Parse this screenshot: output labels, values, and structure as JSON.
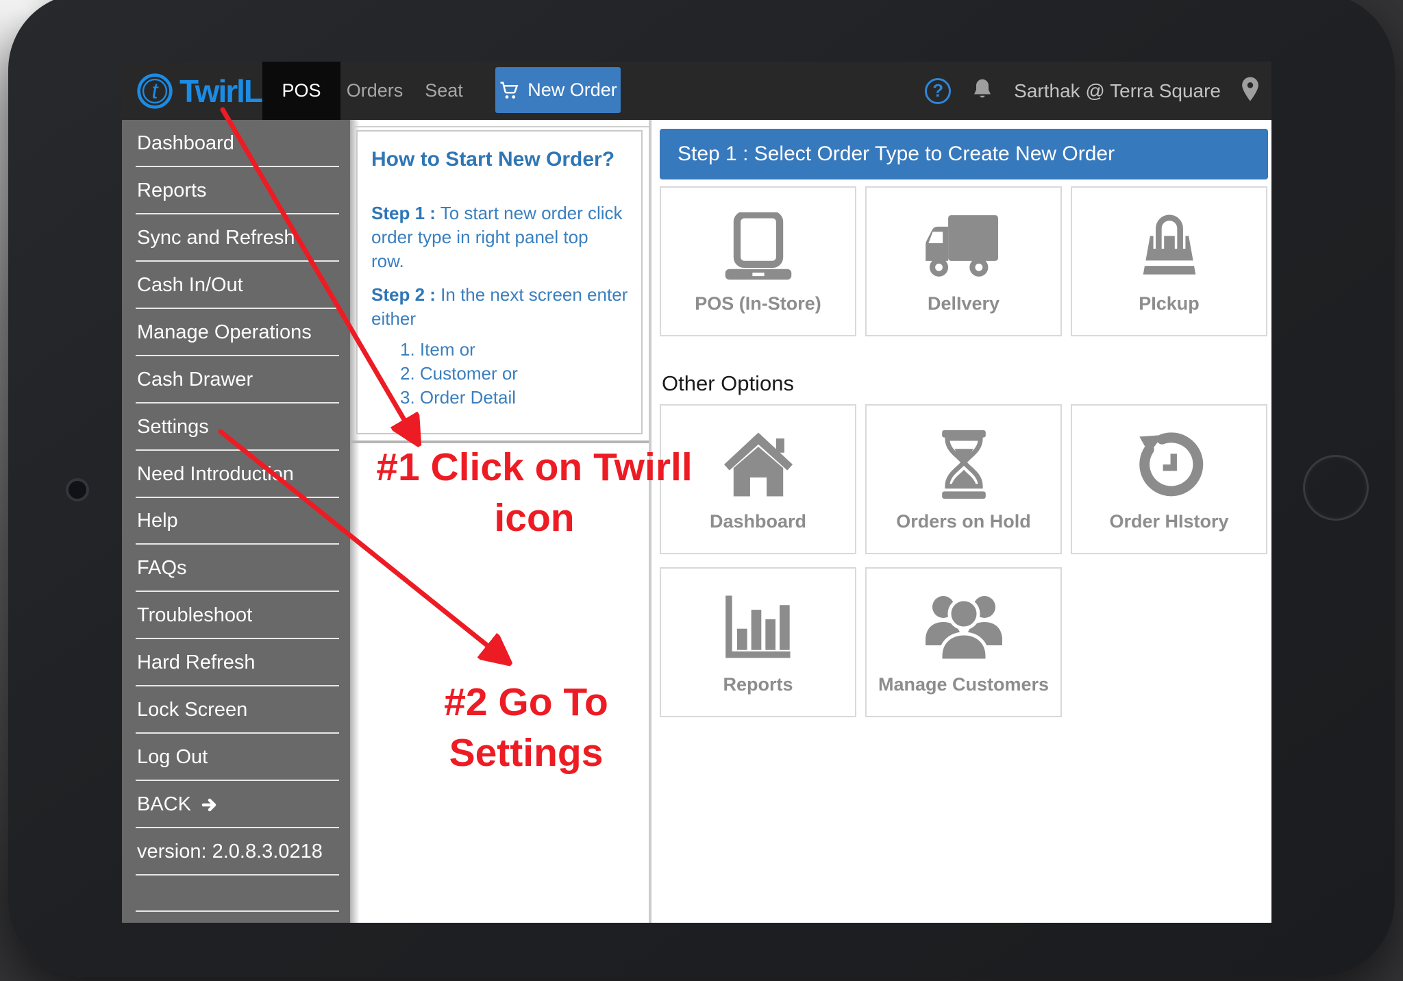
{
  "nav": {
    "brand": "TwirlL",
    "tabs": [
      {
        "label": "POS",
        "active": true
      },
      {
        "label": "Orders",
        "active": false
      },
      {
        "label": "Seat",
        "active": false
      }
    ],
    "new_order": {
      "label": "New Order",
      "icon": "cart-icon",
      "color": "#3b7cc1"
    },
    "help_glyph": "?",
    "user": {
      "label": "Sarthak @ Terra Square",
      "icon": "location-pin-icon"
    }
  },
  "sidebar": {
    "items": [
      {
        "label": "Dashboard"
      },
      {
        "label": "Reports"
      },
      {
        "label": "Sync and Refresh"
      },
      {
        "label": "Cash In/Out"
      },
      {
        "label": "Manage Operations"
      },
      {
        "label": "Cash Drawer"
      },
      {
        "label": "Settings"
      },
      {
        "label": "Need Introduction"
      },
      {
        "label": "Help"
      },
      {
        "label": "FAQs"
      },
      {
        "label": "Troubleshoot"
      },
      {
        "label": "Hard Refresh"
      },
      {
        "label": "Lock Screen"
      },
      {
        "label": "Log Out"
      },
      {
        "label": "BACK",
        "icon": "arrow-right-icon"
      },
      {
        "label": "version: 2.0.8.3.0218",
        "static": true
      }
    ]
  },
  "help_panel": {
    "title": "How to Start New Order?",
    "step1_label": "Step 1 :",
    "step1_text": "To start new order click\norder type in right panel top\nrow.",
    "step2_label": "Step 2 :",
    "step2_text": "In the next screen enter\neither",
    "list": [
      "1. Item or",
      "2. Customer or",
      "3. Order Detail"
    ]
  },
  "order_panel": {
    "header": "Step 1 : Select Order Type to Create New Order",
    "header_color": "#3779bd",
    "primary_tiles": [
      {
        "label": "POS (In-Store)",
        "icon": "laptop-icon"
      },
      {
        "label": "DelIvery",
        "icon": "truck-icon"
      },
      {
        "label": "PIckup",
        "icon": "shopping-bag-icon"
      }
    ],
    "other_options_label": "Other Options",
    "other_tiles_top": [
      {
        "label": "Dashboard",
        "icon": "home-icon"
      },
      {
        "label": "Orders on Hold",
        "icon": "hourglass-icon"
      },
      {
        "label": "Order HIstory",
        "icon": "history-icon"
      }
    ],
    "other_tiles_bottom": [
      {
        "label": "Reports",
        "icon": "bar-chart-icon"
      },
      {
        "label": "Manage Customers",
        "icon": "people-icon"
      }
    ]
  },
  "annotations": {
    "color": "#ed1c24",
    "note1_line1": "#1 Click on Twirll",
    "note1_line2": "icon",
    "note2": "#2 Go To Settings"
  }
}
